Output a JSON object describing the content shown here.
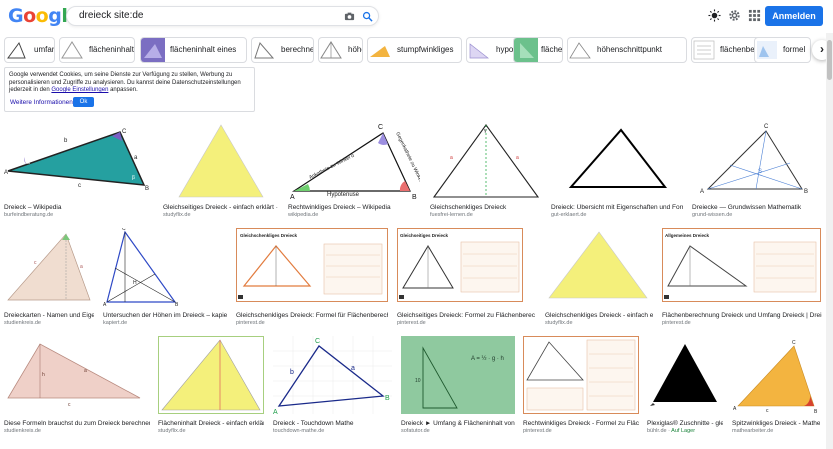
{
  "header": {
    "logo_letters": [
      "G",
      "o",
      "o",
      "g",
      "l",
      "e"
    ],
    "logo_colors": [
      "#4285f4",
      "#ea4335",
      "#fbbc05",
      "#4285f4",
      "#34a853",
      "#ea4335"
    ],
    "query": "dreieck site:de",
    "signin_label": "Anmelden"
  },
  "chips": [
    {
      "label": "umfang"
    },
    {
      "label": "flächeninhalt"
    },
    {
      "label": "flächeninhalt eines"
    },
    {
      "label": "berechnen"
    },
    {
      "label": "höhe"
    },
    {
      "label": "stumpfwinkliges"
    },
    {
      "label": "hypotenuse"
    },
    {
      "label": "fläche"
    },
    {
      "label": "höhenschnittpunkt"
    },
    {
      "label": "flächenberechnung"
    },
    {
      "label": "formel"
    }
  ],
  "cookie": {
    "text_before": "Google verwendet Cookies, um seine Dienste zur Verfügung zu stellen, Werbung zu personalisieren und Zugriffe zu analysieren. Du kannst deine Datenschutzeinstellungen jederzeit in den ",
    "link": "Google Einstellungen",
    "text_after": " anpassen.",
    "more": "Weitere Informationen",
    "ok": "Ok"
  },
  "results": [
    {
      "caption": "Dreieck – Wikipedia",
      "source": "burfeindberatung.de"
    },
    {
      "caption": "Gleichseitiges Dreieck - einfach erklärt · [mit ...",
      "source": "studyflix.de"
    },
    {
      "caption": "Rechtwinkliges Dreieck – Wikipedia",
      "source": "wikipedia.de"
    },
    {
      "caption": "Gleichschenkliges Dreieck",
      "source": "fuesfrei-lernen.de"
    },
    {
      "caption": "Dreieck: Übersicht mit Eigenschaften und Formeln",
      "source": "gut-erklaert.de"
    },
    {
      "caption": "Dreiecke — Grundwissen Mathematik",
      "source": "grund-wissen.de"
    },
    {
      "caption": "Dreieckarten - Namen und Eige...",
      "source": "studienkreis.de"
    },
    {
      "caption": "Untersuchen der Höhen im Dreieck – kapiert.de",
      "source": "kapiert.de"
    },
    {
      "caption": "Gleichschenkliges Dreieck: Formel für Flächenberechnung,...",
      "source": "pinterest.de"
    },
    {
      "caption": "Gleichseitiges Dreieck: Formel zu Flächenberechnun...",
      "source": "pinterest.de"
    },
    {
      "caption": "Gleichschenkliges Dreieck - einfach erkl...",
      "source": "studyflix.de"
    },
    {
      "caption": "Flächenberechnung Dreieck und Umfang Dreieck | Dreieckb...",
      "source": "pinterest.de"
    },
    {
      "caption": "Diese Formeln brauchst du zum Dreieck berechnen!",
      "source": "studienkreis.de"
    },
    {
      "caption": "Flächeninhalt Dreieck - einfach erklärt · [...",
      "source": "studyflix.de"
    },
    {
      "caption": "Dreieck - Touchdown Mathe",
      "source": "touchdown-mathe.de"
    },
    {
      "caption": "Dreieck ► Umfang & Flächeninhalt von a...",
      "source": "sofatutor.de"
    },
    {
      "caption": "Rechtwinkliges Dreieck - Formel zu Flächen...",
      "source": "pinterest.de"
    },
    {
      "caption": "Plexiglas® Zuschnitte - glei...",
      "source": "bühlr.de",
      "badge": "Auf Lager"
    },
    {
      "caption": "Spitzwinkliges Dreieck - Mathere...",
      "source": "mathearbeiter.de"
    }
  ],
  "figure_labels": {
    "wiki_hyp": "Hypotenuse",
    "wiki_kat1": "Ankathete zu Winkel α",
    "wiki_kat2": "Gegenkathete zu Winkel α",
    "card1_title": "Gleichschenkliges Dreieck",
    "card2_title": "Gleichseitiges Dreieck",
    "card3_title": "Allgemeines Dreieck",
    "formula_area": "A = ½ · g · h"
  }
}
